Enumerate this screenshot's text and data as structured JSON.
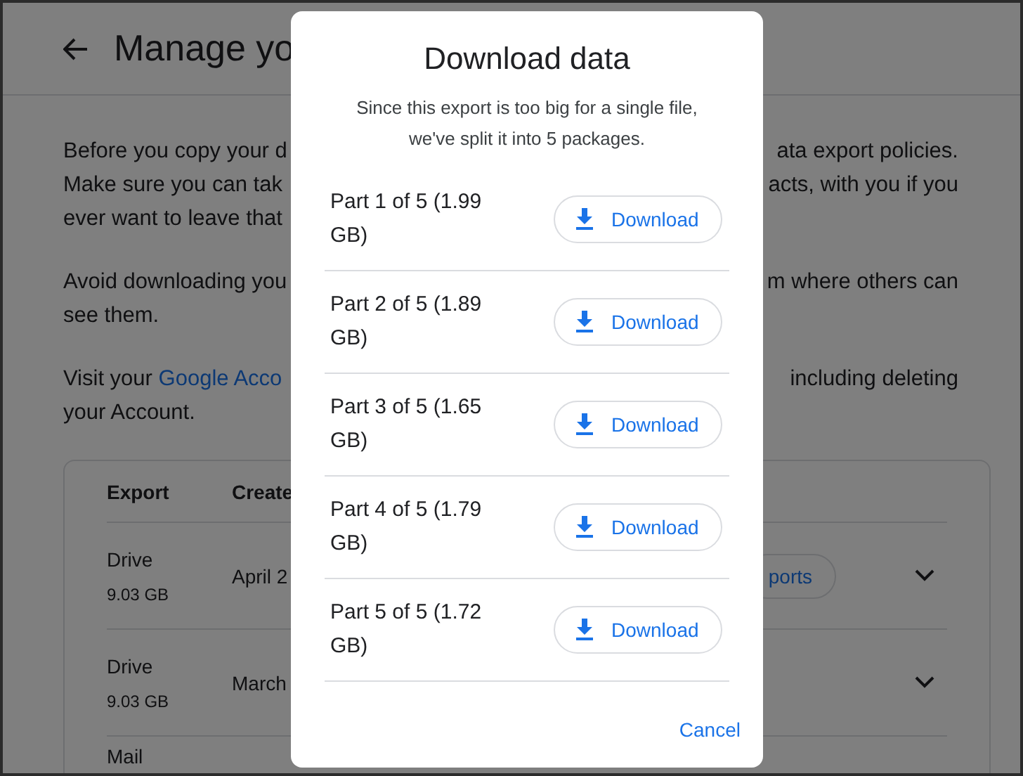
{
  "page": {
    "title": "Manage yo",
    "paragraphs": [
      {
        "lines": [
          {
            "left": "Before you copy your d",
            "right": "ata export policies."
          },
          {
            "left": "Make sure you can tak",
            "right": "acts, with you if you"
          },
          {
            "left": "ever want to leave that"
          }
        ]
      },
      {
        "lines": [
          {
            "left": "Avoid downloading you",
            "right": "m where others can"
          },
          {
            "left": "see them."
          }
        ]
      },
      {
        "lines": [
          {
            "left": "Visit your ",
            "link": "Google Acco",
            "right": "including deleting"
          },
          {
            "left": "your Account."
          }
        ]
      }
    ],
    "table": {
      "columns": [
        "Export",
        "Create"
      ],
      "rows": [
        {
          "name": "Drive",
          "size": "9.03 GB",
          "created": "April 2",
          "action": "ports",
          "expanded": false
        },
        {
          "name": "Drive",
          "size": "9.03 GB",
          "created": "March",
          "expanded": false
        },
        {
          "name": "Mail"
        }
      ]
    }
  },
  "dialog": {
    "title": "Download data",
    "message": "Since this export is too big for a single file, we've split it into 5 packages.",
    "parts": [
      {
        "label": "Part 1 of 5 (1.99 GB)",
        "button": "Download"
      },
      {
        "label": "Part 2 of 5 (1.89 GB)",
        "button": "Download"
      },
      {
        "label": "Part 3 of 5 (1.65 GB)",
        "button": "Download"
      },
      {
        "label": "Part 4 of 5 (1.79 GB)",
        "button": "Download"
      },
      {
        "label": "Part 5 of 5 (1.72 GB)",
        "button": "Download"
      }
    ],
    "cancel": "Cancel"
  }
}
